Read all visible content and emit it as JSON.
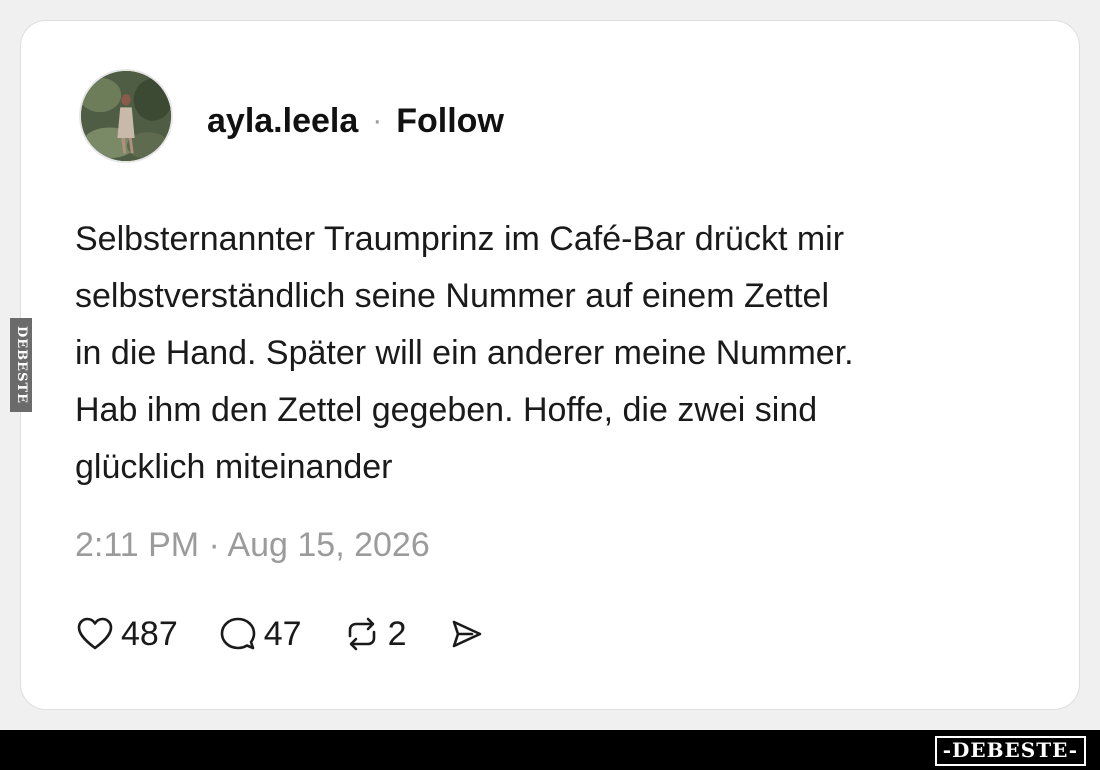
{
  "post": {
    "username": "ayla.leela",
    "separator": "·",
    "follow_label": "Follow",
    "text": "Selbsternannter Traumprinz im Café-Bar drückt mir\nselbstverständlich seine Nummer auf einem Zettel\nin die Hand. Später will ein anderer meine Nummer.\nHab ihm den Zettel gegeben. Hoffe, die zwei sind\nglücklich miteinander",
    "timestamp": "2:11 PM · Aug 15, 2026"
  },
  "actions": {
    "likes": "487",
    "replies": "47",
    "reposts": "2",
    "icons": [
      "heart-icon",
      "reply-bubble-icon",
      "repost-icon",
      "share-send-icon"
    ]
  },
  "watermarks": {
    "bottom": "-DEBESTE-",
    "side": "DEBESTE"
  },
  "colors": {
    "background": "#f0f0f0",
    "card": "#ffffff",
    "text": "#1a1a1a",
    "muted": "#9b9b9b",
    "bottom_bar": "#000000"
  }
}
